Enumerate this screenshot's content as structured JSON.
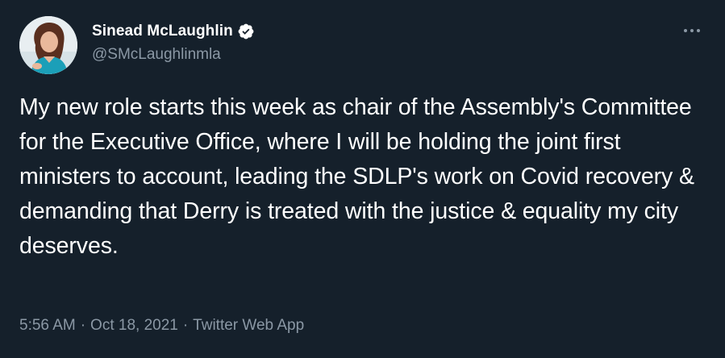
{
  "author": {
    "display_name": "Sinead McLaughlin",
    "handle": "@SMcLaughlinmla",
    "verified": true
  },
  "tweet": {
    "text": "My new role starts this week as chair of the Assembly's Committee for the Executive Office, where I will be holding the joint first ministers to account, leading the SDLP's work on Covid recovery & demanding that Derry is treated with the justice & equality my city deserves."
  },
  "meta": {
    "time": "5:56 AM",
    "separator": "·",
    "date": "Oct 18, 2021",
    "source": "Twitter Web App"
  },
  "icons": {
    "verified": "verified-badge-icon",
    "more": "more-options-icon"
  },
  "colors": {
    "background": "#15202b",
    "primary_text": "#ffffff",
    "secondary_text": "#8b98a5"
  }
}
